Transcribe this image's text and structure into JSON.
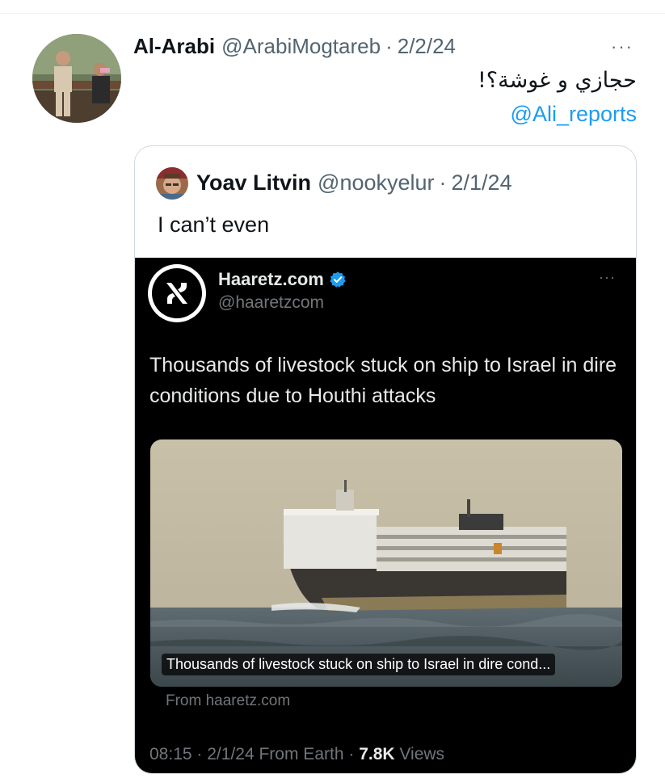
{
  "tweet": {
    "author_name": "Al-Arabi",
    "author_handle": "@ArabiMogtareb",
    "separator": "·",
    "date": "2/2/24",
    "more_label": "···",
    "text_arabic": "حجازي و غوشة؟!",
    "mention": "@Ali_reports"
  },
  "quote": {
    "author_name": "Yoav Litvin",
    "author_handle": "@nookyelur",
    "separator": "·",
    "date": "2/1/24",
    "text": "I can’t even"
  },
  "embedded": {
    "name": "Haaretz.com",
    "handle": "@haaretzcom",
    "more_label": "···",
    "body": "Thousands of livestock stuck on ship to Israel in dire conditions due to Houthi attacks",
    "link_caption": "Thousands of livestock stuck on ship to Israel in dire cond...",
    "source": "From haaretz.com",
    "time": "08:15",
    "date": "2/1/24",
    "location": "From Earth",
    "sep": "·",
    "views_count": "7.8K",
    "views_label": "Views",
    "colors": {
      "background": "#000000",
      "verified": "#1d9bf0",
      "muted_text": "#71767b"
    }
  },
  "colors": {
    "link": "#1d9bf0",
    "muted": "#536471",
    "border": "#cfd9de"
  }
}
